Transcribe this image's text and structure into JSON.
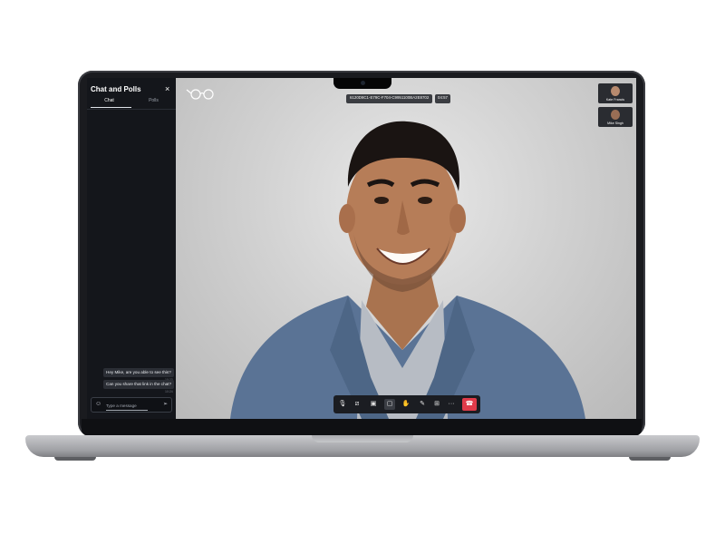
{
  "sidebar": {
    "title": "Chat and Polls",
    "close": "×",
    "tabs": [
      {
        "label": "Chat",
        "active": true
      },
      {
        "label": "Polls",
        "active": false
      }
    ],
    "messages": [
      {
        "text": "Hey Mike, are you able to see this?",
        "time": "10:23"
      },
      {
        "text": "Can you share that link in the chat?",
        "time": "10:24"
      }
    ],
    "input": {
      "placeholder": "Type a message",
      "emoji_icon": "☺",
      "send_icon": "➢"
    }
  },
  "call": {
    "meeting_id": "6120D8C1-E79C-F704-C9951100BA2E8702",
    "timer": "04:57",
    "participants": [
      {
        "name": "Kate Francis"
      },
      {
        "name": "Mike Singh"
      }
    ]
  },
  "controls": {
    "items": [
      {
        "icon": "microphone-icon",
        "glyph": "🎙"
      },
      {
        "icon": "camera-off-icon",
        "glyph": "⧄"
      },
      {
        "icon": "share-screen-icon",
        "glyph": "▣"
      },
      {
        "icon": "chat-icon",
        "glyph": "▢"
      },
      {
        "icon": "raise-hand-icon",
        "glyph": "✋"
      },
      {
        "icon": "reactions-icon",
        "glyph": "✎"
      },
      {
        "icon": "grid-view-icon",
        "glyph": "⊞"
      },
      {
        "icon": "more-icon",
        "glyph": "···"
      }
    ],
    "end_call_glyph": "☎"
  },
  "colors": {
    "sidebar_bg": "#14161b",
    "end_call": "#e03b4a",
    "control_bar": "#1b1d22"
  }
}
